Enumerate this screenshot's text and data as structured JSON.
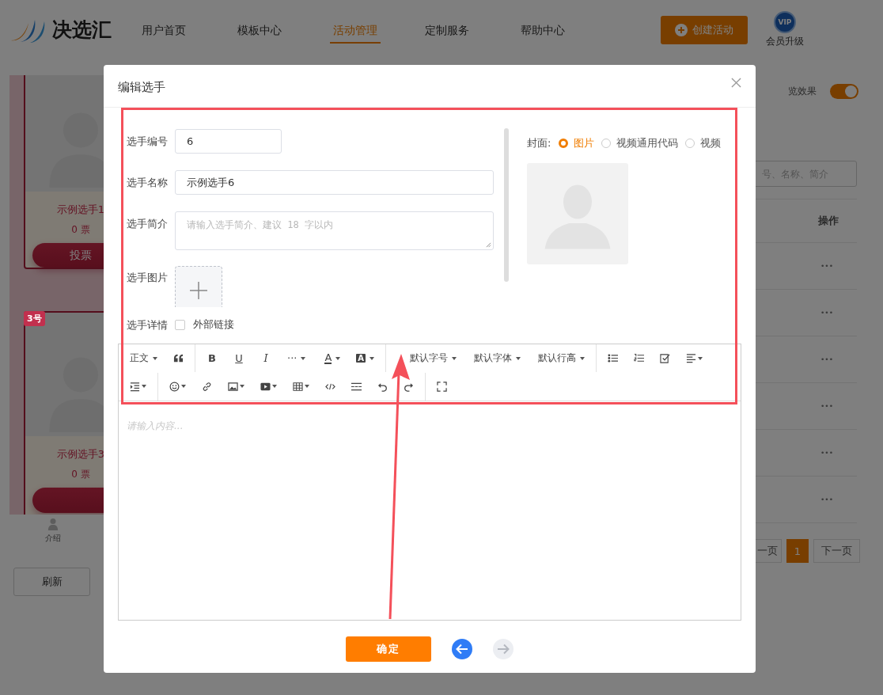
{
  "header": {
    "logo_text": "决选汇",
    "nav": [
      {
        "label": "用户首页",
        "selected": false
      },
      {
        "label": "模板中心",
        "selected": false
      },
      {
        "label": "活动管理",
        "selected": true
      },
      {
        "label": "定制服务",
        "selected": false
      },
      {
        "label": "帮助中心",
        "selected": false
      }
    ],
    "create_button": "创建活动",
    "vip_badge": "VIP",
    "vip_label": "会员升级"
  },
  "left_panel": {
    "cards": [
      {
        "name": "示例选手1",
        "votes": "0 票",
        "vote_button": "投票"
      },
      {
        "badge": "3号",
        "name": "示例选手3",
        "votes": "0 票"
      }
    ],
    "bottom_tab": "介绍",
    "refresh_button": "刷新"
  },
  "right_panel": {
    "preview_label": "览效果",
    "preview_on": true,
    "search_placeholder": "号、名称、简介",
    "column": "操作",
    "row_actions": [
      "•••",
      "•••",
      "•••",
      "•••",
      "•••",
      "•••"
    ],
    "pagination": {
      "prev": "一页",
      "pages": [
        {
          "label": "1",
          "selected": true
        }
      ],
      "next": "下一页"
    }
  },
  "modal": {
    "title": "编辑选手",
    "fields": [
      {
        "label": "选手编号",
        "kind": "input",
        "value": "6"
      },
      {
        "label": "选手名称",
        "kind": "wide-input",
        "value": "示例选手6"
      },
      {
        "label": "选手简介",
        "kind": "textarea",
        "placeholder": "请输入选手简介、建议 18 字以内"
      },
      {
        "label": "选手图片",
        "kind": "upload"
      }
    ],
    "detail": {
      "label": "选手详情",
      "checkbox_label": "外部链接",
      "checked": false
    },
    "cover": {
      "label": "封面:",
      "options": [
        {
          "label": "图片",
          "selected": true
        },
        {
          "label": "视频通用代码",
          "selected": false
        },
        {
          "label": "视频",
          "selected": false
        }
      ]
    },
    "toolbar": {
      "format": "正文",
      "bold": "B",
      "underline": "U",
      "italic": "I",
      "more": "···",
      "font_color": "A",
      "background_color": "A",
      "font_size": "默认字号",
      "font_family": "默认字体",
      "line_height": "默认行高"
    },
    "editor_placeholder": "请输入内容...",
    "confirm_button": "确定",
    "nav_arrows": [
      {
        "disabled": false
      },
      {
        "disabled": true
      }
    ]
  }
}
